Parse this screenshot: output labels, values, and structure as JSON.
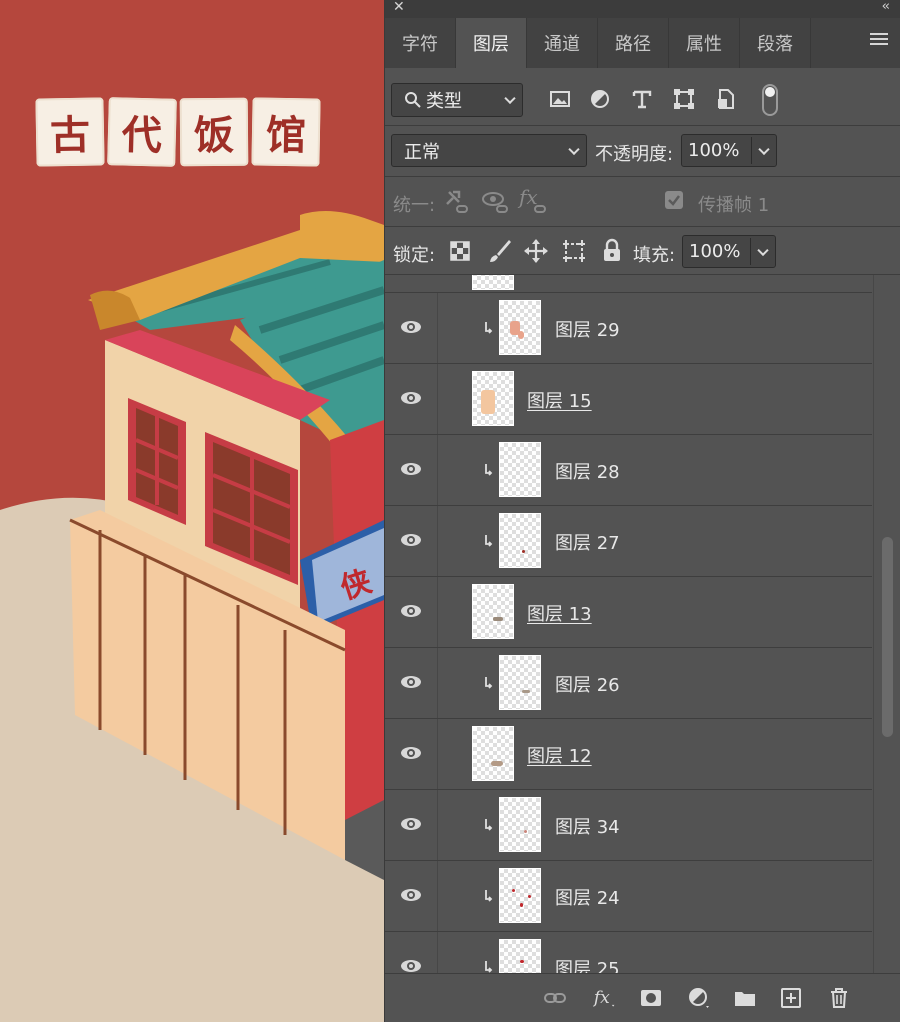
{
  "canvas": {
    "title_chars": [
      "古",
      "代",
      "饭",
      "馆"
    ],
    "sign_text": "侠"
  },
  "panel": {
    "tabs": [
      {
        "label": "字符",
        "active": false
      },
      {
        "label": "图层",
        "active": true
      },
      {
        "label": "通道",
        "active": false
      },
      {
        "label": "路径",
        "active": false
      },
      {
        "label": "属性",
        "active": false
      },
      {
        "label": "段落",
        "active": false
      }
    ],
    "filter": {
      "kind_label": "类型"
    },
    "blend": {
      "mode": "正常",
      "opacity_label": "不透明度:",
      "opacity_value": "100%"
    },
    "unify": {
      "label": "统一:",
      "propagate_label": "传播帧 1"
    },
    "lock": {
      "label": "锁定:",
      "fill_label": "填充:",
      "fill_value": "100%"
    },
    "layers": [
      {
        "name": "图层 29",
        "clipped": true,
        "underlined": false
      },
      {
        "name": "图层 15",
        "clipped": false,
        "underlined": true
      },
      {
        "name": "图层 28",
        "clipped": true,
        "underlined": false
      },
      {
        "name": "图层 27",
        "clipped": true,
        "underlined": false
      },
      {
        "name": "图层 13",
        "clipped": false,
        "underlined": true
      },
      {
        "name": "图层 26",
        "clipped": true,
        "underlined": false
      },
      {
        "name": "图层 12",
        "clipped": false,
        "underlined": true
      },
      {
        "name": "图层 34",
        "clipped": true,
        "underlined": false
      },
      {
        "name": "图层 24",
        "clipped": true,
        "underlined": false
      },
      {
        "name": "图层 25",
        "clipped": true,
        "underlined": false
      }
    ]
  }
}
